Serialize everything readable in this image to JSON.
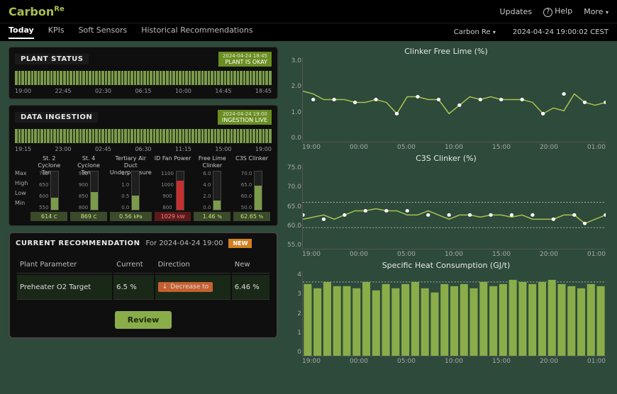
{
  "brand": {
    "name": "Carbon",
    "suffix": "Re"
  },
  "topnav": {
    "updates": "Updates",
    "help": "Help",
    "more": "More"
  },
  "tabs": [
    "Today",
    "KPIs",
    "Soft Sensors",
    "Historical Recommendations"
  ],
  "active_tab": "Today",
  "plant_selector": "Carbon Re",
  "clock": "2024-04-24 19:00:02 CEST",
  "plant_status": {
    "title": "PLANT STATUS",
    "badge_ts": "2024-04-24 18:45",
    "badge_label": "PLANT IS OKAY",
    "ticks": [
      "19:00",
      "22:45",
      "02:30",
      "06:15",
      "10:00",
      "14:45",
      "18:45"
    ]
  },
  "data_ingestion": {
    "title": "DATA INGESTION",
    "badge_ts": "2024-04-24 19:00",
    "badge_label": "INGESTION LIVE",
    "ticks": [
      "19:15",
      "23:00",
      "02:45",
      "06:30",
      "11:15",
      "15:00",
      "19:00"
    ]
  },
  "gauge_row_labels": [
    "Max",
    "High",
    "Low",
    "Min"
  ],
  "gauges": [
    {
      "title": "St. 2 Cyclone Temp",
      "scale": [
        "700",
        "650",
        "600",
        "550"
      ],
      "value": "614",
      "unit": "C",
      "fill": 0.32,
      "danger": false
    },
    {
      "title": "St. 4 Cyclone Temp",
      "scale": [
        "950",
        "900",
        "850",
        "800"
      ],
      "value": "869",
      "unit": "C",
      "fill": 0.46,
      "danger": false
    },
    {
      "title": "Tertiary Air Duct Underpressure",
      "scale": [
        "1.5",
        "1.0",
        "0.5",
        "0.0"
      ],
      "value": "0.56",
      "unit": "kPa",
      "fill": 0.37,
      "danger": false
    },
    {
      "title": "ID Fan Power",
      "scale": [
        "1100",
        "1000",
        "900",
        "800"
      ],
      "value": "1029",
      "unit": "kW",
      "fill": 0.76,
      "danger": true
    },
    {
      "title": "Free Lime Clinker",
      "scale": [
        "6.0",
        "4.0",
        "2.0",
        "0.0"
      ],
      "value": "1.46",
      "unit": "%",
      "fill": 0.24,
      "danger": false
    },
    {
      "title": "C3S Clinker",
      "scale": [
        "70.0",
        "65.0",
        "60.0",
        "50.0"
      ],
      "value": "62.65",
      "unit": "%",
      "fill": 0.63,
      "danger": false
    }
  ],
  "recommendation": {
    "title": "CURRENT RECOMMENDATION",
    "for_label": "For 2024-04-24 19:00",
    "new_badge": "NEW",
    "columns": [
      "Plant Parameter",
      "Current",
      "Direction",
      "New"
    ],
    "row": {
      "param": "Preheater O2 Target",
      "current": "6.5 %",
      "direction": "Decrease to",
      "new": "6.46 %"
    },
    "review": "Review"
  },
  "chart_data": [
    {
      "type": "line",
      "title": "Clinker Free Lime (%)",
      "ylabel": "",
      "xlabel": "",
      "ylim": [
        0.0,
        3.0
      ],
      "yticks": [
        "3.0",
        "2.0",
        "1.0",
        "0.0"
      ],
      "xticks": [
        "19:00",
        "00:00",
        "05:00",
        "10:00",
        "15:00",
        "20:00",
        "01:00"
      ],
      "series": [
        {
          "name": "Free Lime",
          "x": [
            0,
            1,
            2,
            3,
            4,
            5,
            6,
            7,
            8,
            9,
            10,
            11,
            12,
            13,
            14,
            15,
            16,
            17,
            18,
            19,
            20,
            21,
            22,
            23,
            24,
            25,
            26,
            27,
            28,
            29
          ],
          "y": [
            1.8,
            1.7,
            1.5,
            1.5,
            1.5,
            1.4,
            1.4,
            1.5,
            1.4,
            1.0,
            1.6,
            1.6,
            1.5,
            1.5,
            1.0,
            1.3,
            1.6,
            1.5,
            1.6,
            1.5,
            1.5,
            1.5,
            1.4,
            1.0,
            1.2,
            1.1,
            1.7,
            1.4,
            1.3,
            1.4
          ]
        }
      ],
      "points": [
        [
          1,
          1.5
        ],
        [
          3,
          1.5
        ],
        [
          5,
          1.4
        ],
        [
          7,
          1.5
        ],
        [
          9,
          1.0
        ],
        [
          11,
          1.6
        ],
        [
          13,
          1.5
        ],
        [
          15,
          1.3
        ],
        [
          17,
          1.5
        ],
        [
          19,
          1.5
        ],
        [
          21,
          1.5
        ],
        [
          23,
          1.0
        ],
        [
          25,
          1.7
        ],
        [
          27,
          1.4
        ],
        [
          29,
          1.4
        ]
      ]
    },
    {
      "type": "line",
      "title": "C3S Clinker (%)",
      "ylabel": "",
      "xlabel": "",
      "ylim": [
        55.0,
        75.0
      ],
      "yticks": [
        "75.0",
        "70.0",
        "65.0",
        "60.0",
        "55.0"
      ],
      "xticks": [
        "19:00",
        "00:00",
        "05:00",
        "10:00",
        "15:00",
        "20:00",
        "01:00"
      ],
      "ref_lines": [
        66,
        60
      ],
      "series": [
        {
          "name": "C3S",
          "x": [
            0,
            1,
            2,
            3,
            4,
            5,
            6,
            7,
            8,
            9,
            10,
            11,
            12,
            13,
            14,
            15,
            16,
            17,
            18,
            19,
            20,
            21,
            22,
            23,
            24,
            25,
            26,
            27,
            28,
            29
          ],
          "y": [
            62,
            62.5,
            63,
            62,
            63,
            64,
            64,
            64.5,
            64,
            64,
            63,
            63,
            64,
            63,
            62,
            63,
            63,
            62.5,
            63,
            63,
            62.5,
            63,
            62,
            62,
            62,
            63,
            63,
            61,
            62,
            63
          ]
        }
      ],
      "points": [
        [
          0,
          63
        ],
        [
          2,
          62
        ],
        [
          4,
          63
        ],
        [
          6,
          64
        ],
        [
          8,
          64
        ],
        [
          10,
          64
        ],
        [
          12,
          63
        ],
        [
          14,
          63
        ],
        [
          16,
          63
        ],
        [
          18,
          63
        ],
        [
          20,
          63
        ],
        [
          22,
          63
        ],
        [
          24,
          62
        ],
        [
          26,
          63
        ],
        [
          27,
          61
        ],
        [
          29,
          63
        ]
      ]
    },
    {
      "type": "bar",
      "title": "Specific Heat Consumption (GJ/t)",
      "ylabel": "",
      "xlabel": "",
      "ylim": [
        0,
        4
      ],
      "yticks": [
        "4",
        "3",
        "2",
        "1",
        "0"
      ],
      "xticks": [
        "19:00",
        "00:00",
        "05:00",
        "10:00",
        "15:00",
        "20:00",
        "01:00"
      ],
      "ref_lines": [
        3.5
      ],
      "categories": [
        "19",
        "20",
        "21",
        "22",
        "23",
        "00",
        "01",
        "02",
        "03",
        "04",
        "05",
        "06",
        "07",
        "08",
        "09",
        "10",
        "11",
        "12",
        "13",
        "14",
        "15",
        "16",
        "17",
        "18",
        "19",
        "20",
        "21",
        "22",
        "23",
        "00",
        "01"
      ],
      "values": [
        3.4,
        3.2,
        3.5,
        3.3,
        3.3,
        3.2,
        3.5,
        3.1,
        3.4,
        3.2,
        3.4,
        3.5,
        3.2,
        3.0,
        3.4,
        3.3,
        3.4,
        3.2,
        3.5,
        3.3,
        3.4,
        3.6,
        3.5,
        3.4,
        3.5,
        3.6,
        3.4,
        3.3,
        3.2,
        3.4,
        3.3
      ]
    }
  ]
}
